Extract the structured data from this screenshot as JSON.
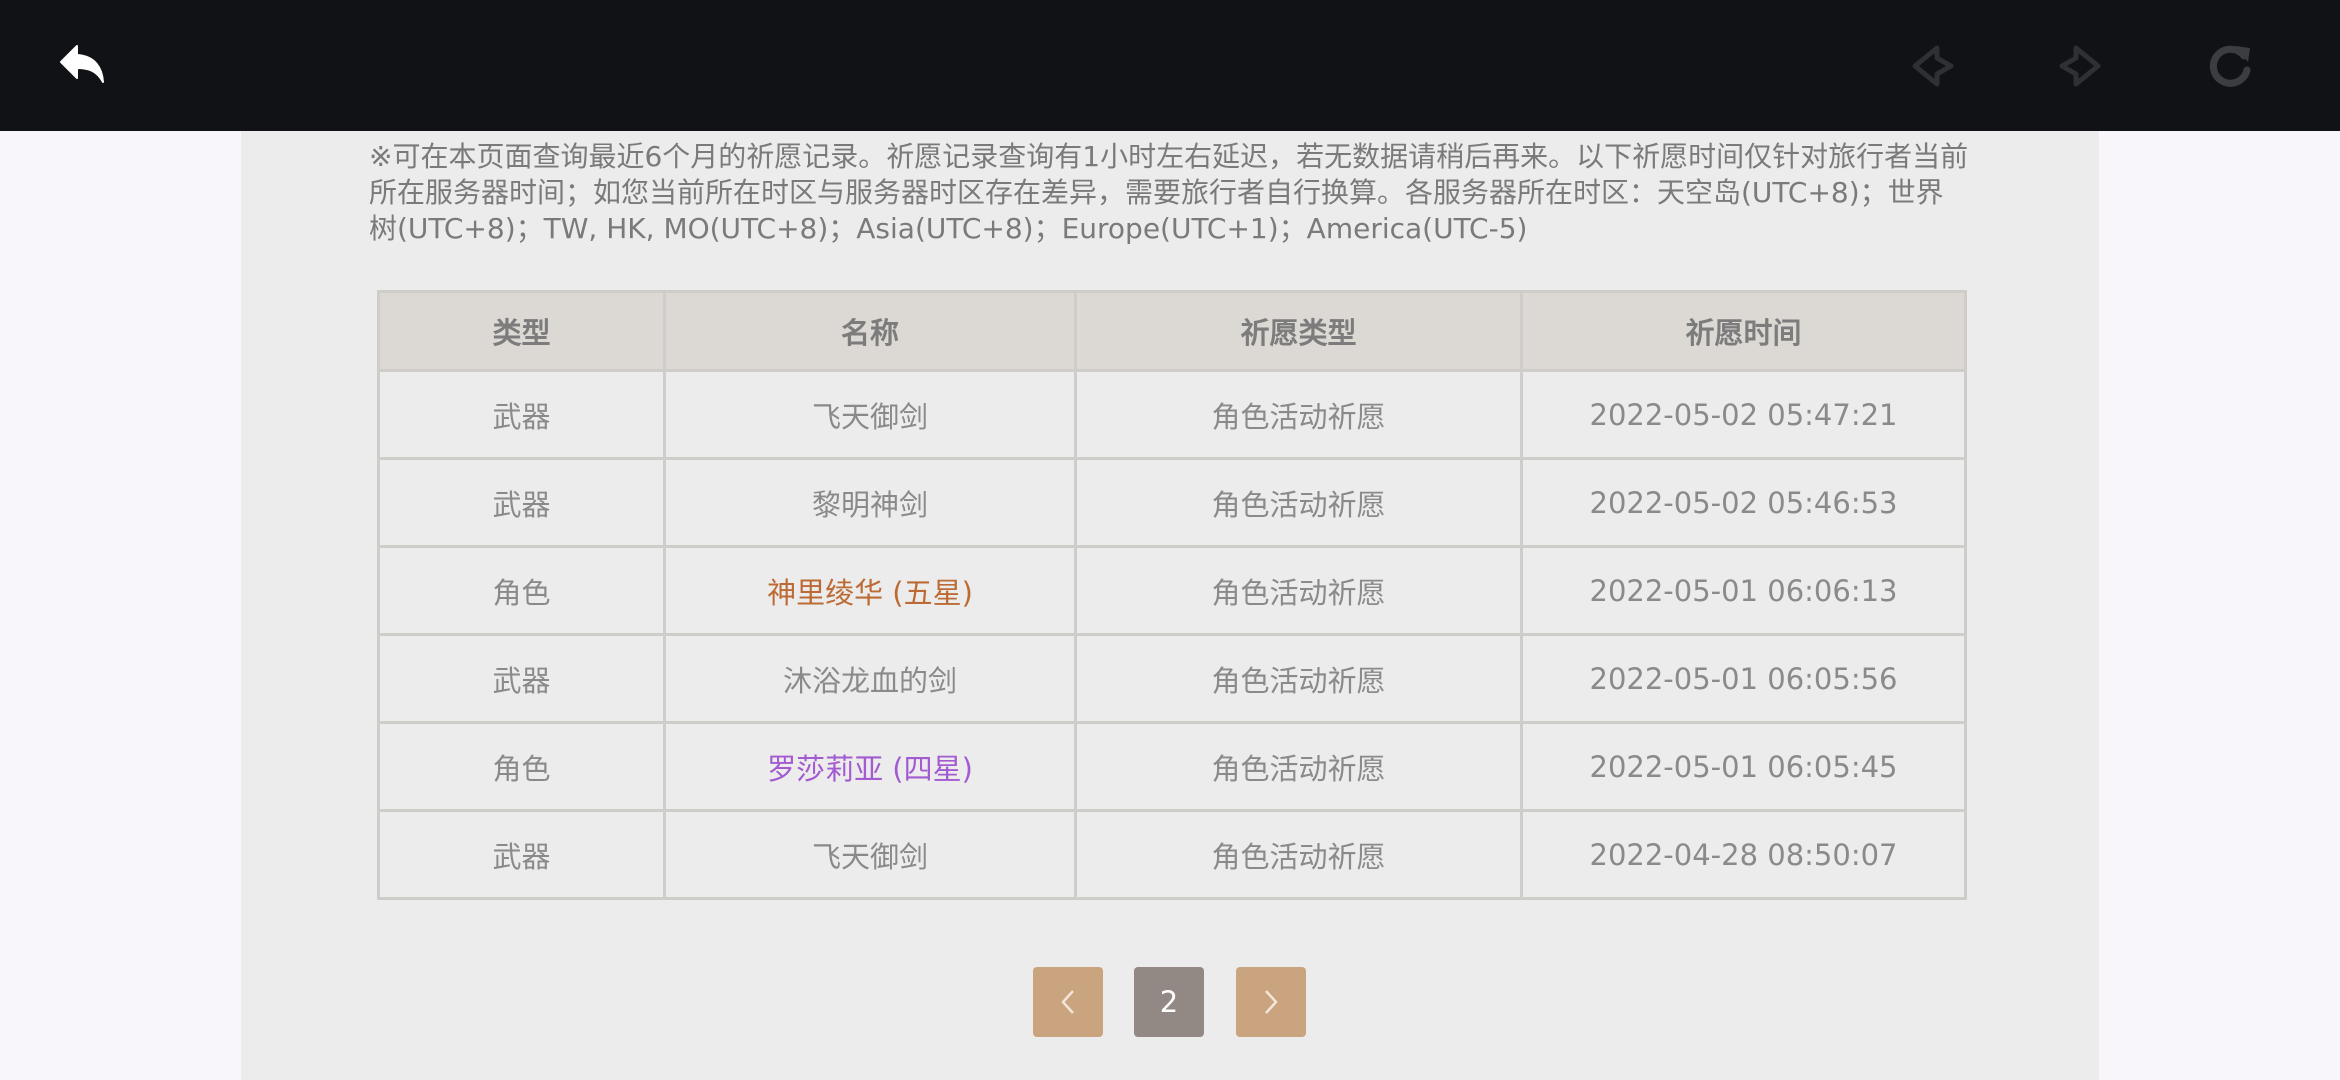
{
  "toolbar": {
    "back_icon": "back-arrow-icon",
    "prev_icon": "nav-prev-icon",
    "next_icon": "nav-next-icon",
    "reload_icon": "reload-icon"
  },
  "notice": {
    "text": "※可在本页面查询最近6个月的祈愿记录。祈愿记录查询有1小时左右延迟，若无数据请稍后再来。以下祈愿时间仅针对旅行者当前所在服务器时间；如您当前所在时区与服务器时区存在差异，需要旅行者自行换算。各服务器所在时区：天空岛(UTC+8)；世界树(UTC+8)；TW, HK, MO(UTC+8)；Asia(UTC+8)；Europe(UTC+1)；America(UTC-5)"
  },
  "table": {
    "headers": [
      "类型",
      "名称",
      "祈愿类型",
      "祈愿时间"
    ],
    "rows": [
      {
        "type": "武器",
        "name": "飞天御剑",
        "wish_type": "角色活动祈愿",
        "time": "2022-05-02 05:47:21"
      },
      {
        "type": "武器",
        "name": "黎明神剑",
        "wish_type": "角色活动祈愿",
        "time": "2022-05-02 05:46:53"
      },
      {
        "type": "角色",
        "name": "神里绫华 (五星)",
        "wish_type": "角色活动祈愿",
        "time": "2022-05-01 06:06:13"
      },
      {
        "type": "武器",
        "name": "沐浴龙血的剑",
        "wish_type": "角色活动祈愿",
        "time": "2022-05-01 06:05:56"
      },
      {
        "type": "角色",
        "name": "罗莎莉亚 (四星)",
        "wish_type": "角色活动祈愿",
        "time": "2022-05-01 06:05:45"
      },
      {
        "type": "武器",
        "name": "飞天御剑",
        "wish_type": "角色活动祈愿",
        "time": "2022-04-28 08:50:07"
      }
    ]
  },
  "pagination": {
    "current_page": "2",
    "prev_icon": "chevron-left-icon",
    "next_icon": "chevron-right-icon"
  },
  "colors": {
    "five_star": "#bd6b34",
    "four_star": "#a35bd1",
    "pager_active": "#938984",
    "pager_arrow": "#c9a47e"
  }
}
